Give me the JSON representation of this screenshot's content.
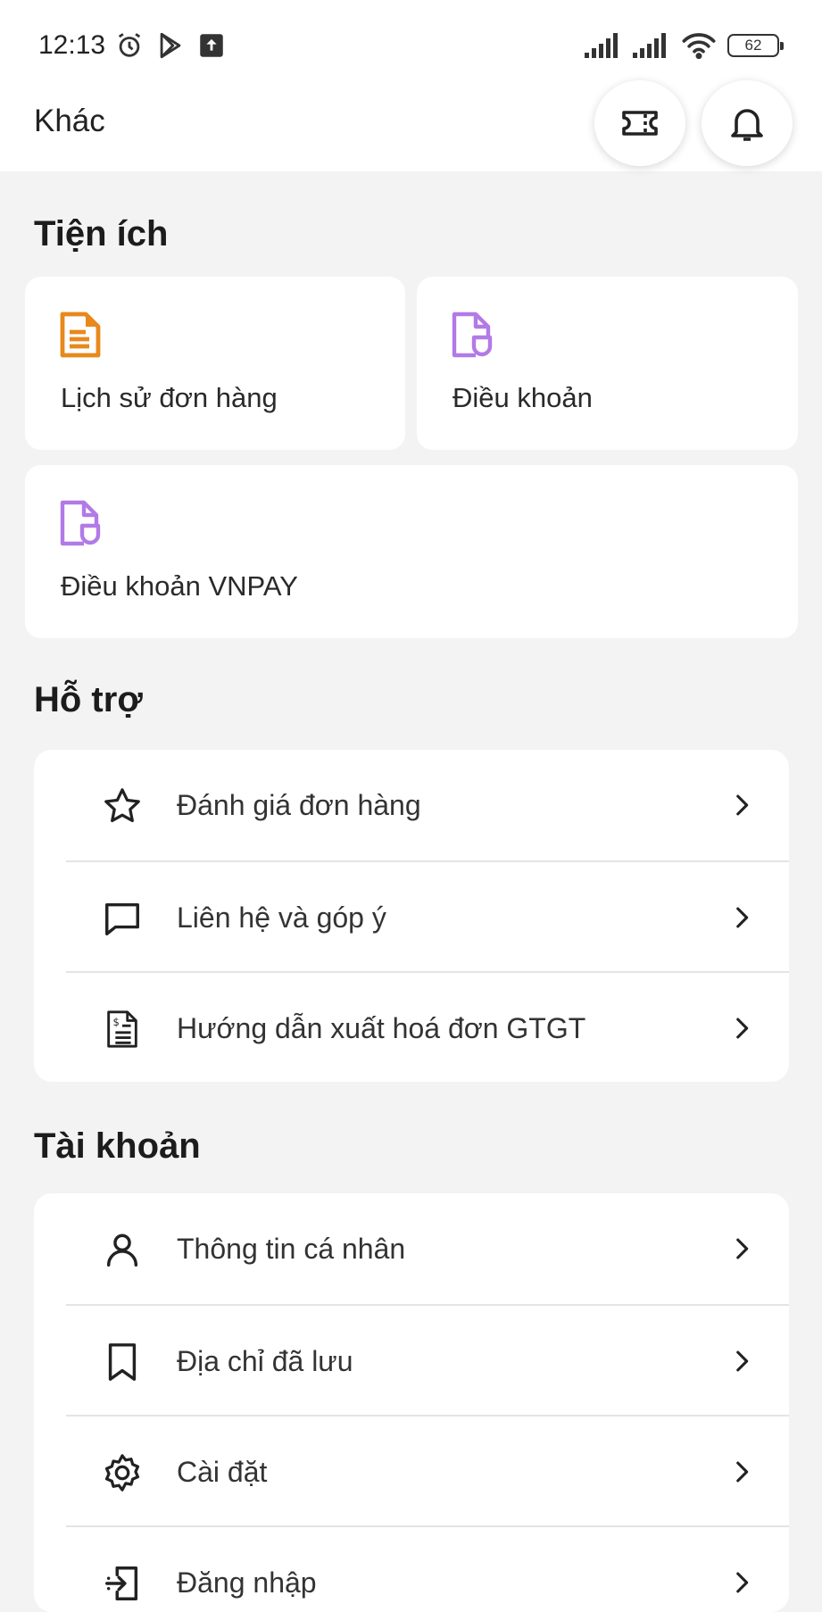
{
  "status_bar": {
    "time": "12:13",
    "battery": "62",
    "icons": [
      "alarm-icon",
      "play-store-icon",
      "upload-icon",
      "signal-icon",
      "signal-icon",
      "wifi-icon",
      "battery-icon"
    ]
  },
  "header": {
    "title": "Khác",
    "actions": [
      "voucher-icon",
      "bell-icon"
    ]
  },
  "sections": {
    "utilities": {
      "title": "Tiện ích",
      "tiles": [
        {
          "label": "Lịch sử đơn hàng",
          "icon": "order-history-icon",
          "color": "#e8891b"
        },
        {
          "label": "Điều khoản",
          "icon": "terms-document-icon",
          "color": "#b27ae6"
        },
        {
          "label": "Điều khoản VNPAY",
          "icon": "terms-document-icon",
          "color": "#b27ae6"
        }
      ]
    },
    "support": {
      "title": "Hỗ trợ",
      "items": [
        {
          "label": "Đánh giá đơn hàng",
          "icon": "star-icon"
        },
        {
          "label": "Liên hệ và góp ý",
          "icon": "chat-icon"
        },
        {
          "label": "Hướng dẫn xuất hoá đơn GTGT",
          "icon": "invoice-icon"
        }
      ]
    },
    "account": {
      "title": "Tài khoản",
      "items": [
        {
          "label": "Thông tin cá nhân",
          "icon": "user-icon"
        },
        {
          "label": "Địa chỉ đã lưu",
          "icon": "bookmark-icon"
        },
        {
          "label": "Cài đặt",
          "icon": "gear-icon"
        },
        {
          "label": "Đăng nhập",
          "icon": "login-icon"
        }
      ]
    }
  },
  "colors": {
    "background": "#f3f3f3",
    "card": "#ffffff",
    "accent_orange": "#e8891b",
    "accent_purple": "#b27ae6",
    "text": "#1c1c1c"
  }
}
